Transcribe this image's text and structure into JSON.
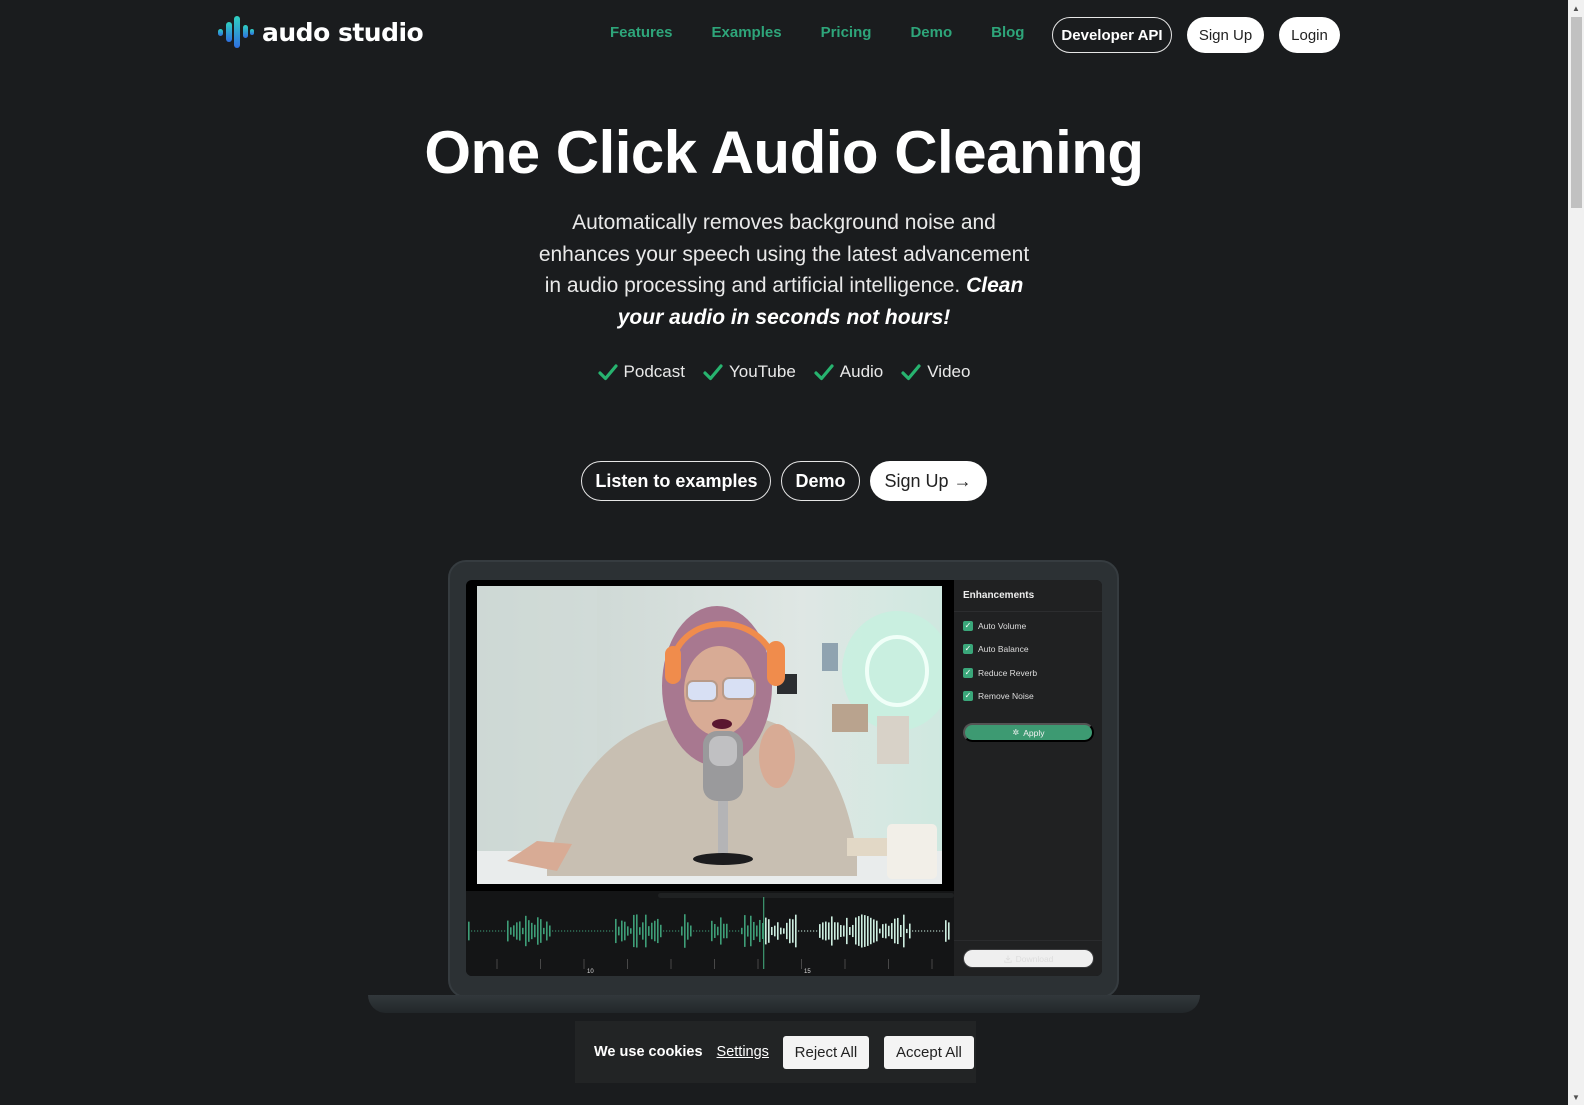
{
  "brand": {
    "name": "audo studio",
    "accent": "#2ea57a"
  },
  "nav": {
    "links": [
      "Features",
      "Examples",
      "Pricing",
      "Demo",
      "Blog"
    ],
    "developer_api": "Developer API",
    "sign_up": "Sign Up",
    "login": "Login"
  },
  "hero": {
    "title": "One Click Audio Cleaning",
    "subtitle": "Automatically removes background noise and enhances your speech using the latest advancement in audio processing and artificial intelligence.",
    "subtitle_emphasis": "Clean your audio in seconds not hours!",
    "use_cases": [
      "Podcast",
      "YouTube",
      "Audio",
      "Video"
    ],
    "cta": {
      "examples": "Listen to examples",
      "demo": "Demo",
      "sign_up": "Sign Up",
      "sign_up_arrow": "→"
    }
  },
  "app_mockup": {
    "video_alt": "Woman with purple hair wearing orange headphones speaking into a studio microphone",
    "panel_title": "Enhancements",
    "enhancements": [
      {
        "label": "Auto Volume",
        "checked": true
      },
      {
        "label": "Auto Balance",
        "checked": true
      },
      {
        "label": "Reduce Reverb",
        "checked": true
      },
      {
        "label": "Remove Noise",
        "checked": true
      }
    ],
    "apply_label": "Apply",
    "download_label": "Download",
    "timeline_labels": [
      "10",
      "15"
    ],
    "playhead_progress": 0.61
  },
  "cookies": {
    "text": "We use cookies",
    "settings": "Settings",
    "reject": "Reject All",
    "accept": "Accept All"
  },
  "scrollbar": {
    "up": "▲",
    "down": "▼"
  }
}
